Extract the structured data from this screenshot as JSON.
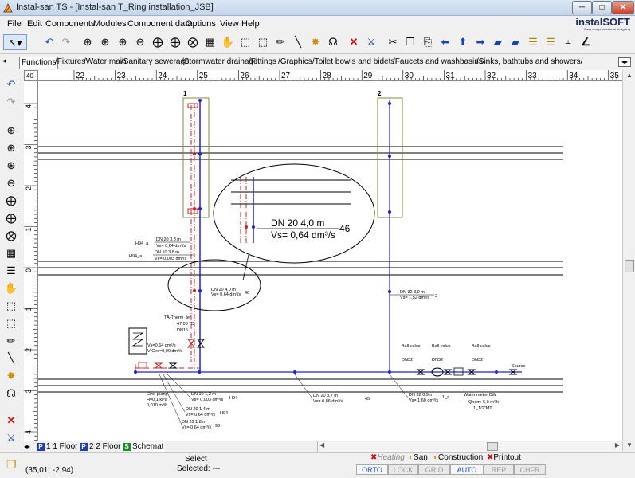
{
  "window": {
    "title": "Instal-san TS - [Instal-san T_Ring installation_JSB]",
    "min_glyph": "─",
    "max_glyph": "□",
    "close_glyph": "✕"
  },
  "brand": {
    "name": "instalSOFT",
    "tagline": "Easy and professional designing"
  },
  "menu": [
    "File",
    "Edit",
    "Components",
    "Modules",
    "Component data",
    "Options",
    "View",
    "Help"
  ],
  "tabs": [
    {
      "label": "Functions",
      "active": true
    },
    {
      "label": "Fixtures",
      "active": false
    },
    {
      "label": "Water main",
      "active": false
    },
    {
      "label": "Sanitary sewerage",
      "active": false
    },
    {
      "label": "Stormwater drainage",
      "active": false
    },
    {
      "label": "Fittings",
      "active": false
    },
    {
      "label": "Graphics",
      "active": false
    },
    {
      "label": "Toilet bowls and bidets",
      "active": false
    },
    {
      "label": "Faucets and washbasins",
      "active": false
    },
    {
      "label": "Sinks, bathtubs and showers",
      "active": false
    }
  ],
  "ruler": {
    "corner_label": "40",
    "h_ticks": [
      "22",
      "23",
      "24",
      "25",
      "26",
      "27",
      "28",
      "29",
      "30",
      "31",
      "32",
      "33",
      "34",
      "35"
    ],
    "v_ticks": [
      "4",
      "3",
      "2",
      "1",
      "0",
      "-1",
      "-2",
      "-3",
      "-4"
    ]
  },
  "floors": [
    {
      "badge": "P",
      "label": "1 1 Floor"
    },
    {
      "badge": "P",
      "label": "2 2 Floor"
    },
    {
      "badge": "S",
      "label": "Schemat"
    }
  ],
  "status": {
    "coords": "(35,01; -2,94)",
    "select": "Select",
    "selected": "Selected: ---"
  },
  "modules": [
    "Heating",
    "San",
    "Construction",
    "Printout"
  ],
  "modes": [
    {
      "label": "ORTO",
      "on": true
    },
    {
      "label": "LOCK",
      "on": false
    },
    {
      "label": "GRID",
      "on": false
    },
    {
      "label": "AUTO",
      "on": true
    },
    {
      "label": "REP",
      "on": false
    },
    {
      "label": "CHFR",
      "on": false
    }
  ],
  "drawing": {
    "riser_1": "1",
    "riser_2": "2",
    "zoom_label_1": "DN 20 4,0 m",
    "zoom_label_2": "Vs= 0,64 dm³/s",
    "zoom_label_num": "46",
    "h94a_pipe": "DN 20 3,8 m",
    "h94a_vs": "Vs= 0,64 dm³/s",
    "h94a_tag": "H94_a",
    "h94a_pipe2": "DN 10 3,8 m",
    "h94a_vs2": "Vs= 0,003 dm³/s",
    "h94a_tag2": "H94_a",
    "small_pipe": "DN 20 4,0 m",
    "small_vs": "Vs= 0,64 dm³/s",
    "small_num": "46",
    "r2_pipe": "DN 32 3,9 m",
    "r2_vs": "Vs= 1,52 dm³/s",
    "r2_num": "2",
    "therm_1": "TA-Therm_ter",
    "therm_2": "47,00 °C",
    "therm_3": "DN15",
    "vs_circ_1": "Vs=0,64 dm³/s",
    "vs_circ_2": "V Circ=0,00 dm³/s",
    "ball_1": "Ball valve",
    "ball_2": "Ball valve",
    "ball_3": "Ball valve",
    "dn32_1": "DN32",
    "dn32_2": "DN32",
    "dn32_3": "DN32",
    "source": "Source",
    "circ_1": "Circ. pump",
    "circ_2": "H=0,1 kPa",
    "circ_3": "0,010 m³/h",
    "p1_pipe": "DN 10 1,2 m",
    "p1_vs": "Vs= 0,003 dm³/s",
    "p1_tag": "H94",
    "p2_pipe": "DN 20 1,4 m",
    "p2_vs": "Vs= 0,64 dm³/s",
    "p2_tag": "H94",
    "p3_pipe": "DN 20 1,8 m",
    "p3_vs": "Vs= 0,64 dm³/s",
    "p3_tag": "93",
    "p4_pipe": "DN 20 3,7 m",
    "p4_vs": "Vs= 0,86 dm³/s",
    "p4_tag": "45",
    "p5_pipe": "DN 32 0,9 m",
    "p5_vs": "Vs= 1,60 dm³/s",
    "p5_tag": "1_a",
    "meter_1": "Water meter CW",
    "meter_2": "Qnom: 6,0 m³/h",
    "meter_3": "1_1/2\"MT"
  },
  "colors": {
    "pipe_blue": "#2222cc",
    "pipe_red": "#cc2222",
    "riser_box": "#8a8a3a",
    "hatch_line": "#000000"
  }
}
